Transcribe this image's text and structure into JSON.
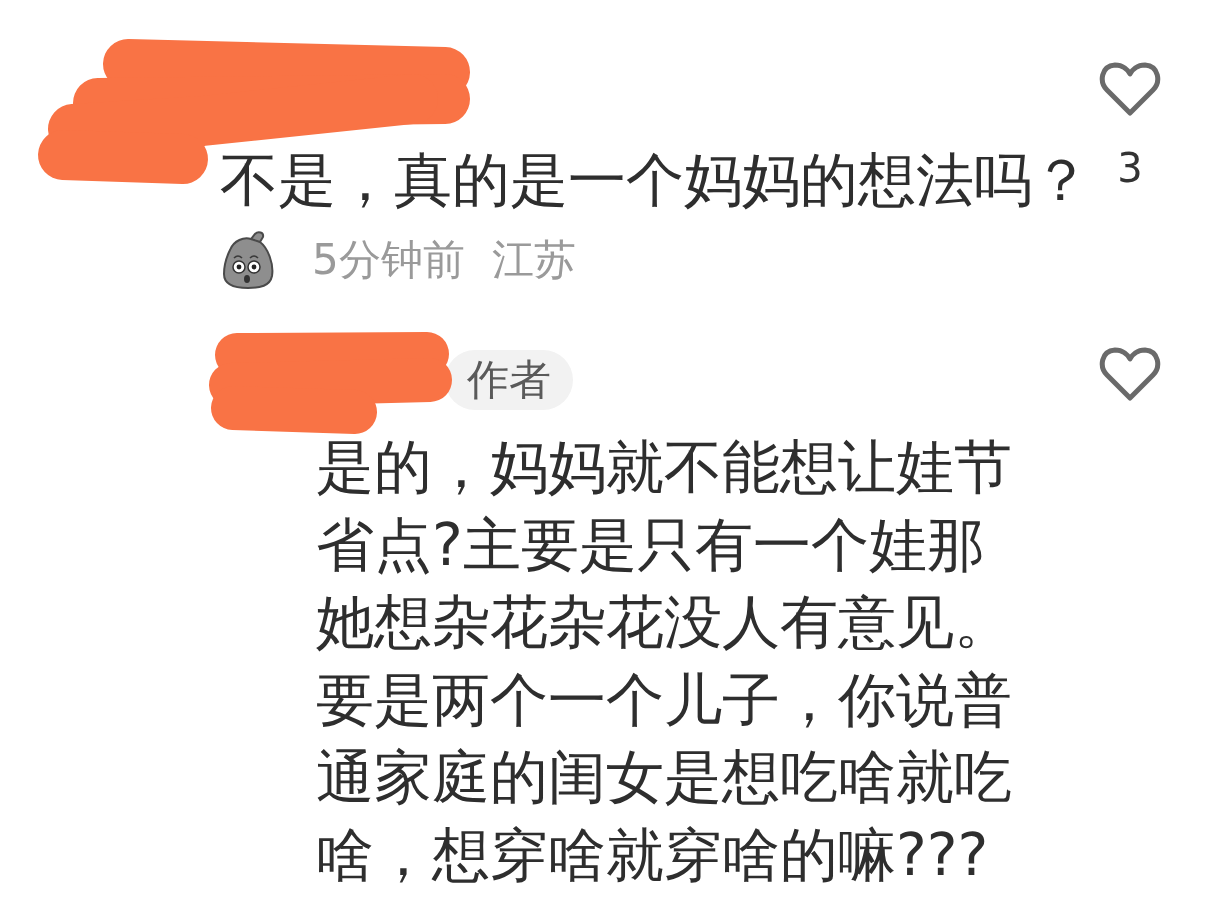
{
  "comments": [
    {
      "username_redacted": true,
      "text": "不是，真的是一个妈妈的想法吗？",
      "sticker": true,
      "time": "5分钟前",
      "location": "江苏",
      "liked": false,
      "like_count": "3",
      "replies": [
        {
          "username_redacted": true,
          "badge": "作者",
          "text": "是的，妈妈就不能想让娃节省点?主要是只有一个娃那她想杂花杂花没人有意见。要是两个一个儿子，你说普通家庭的闺女是想吃啥就吃啥，想穿啥就穿啥的嘛???",
          "liked": false
        }
      ]
    }
  ]
}
